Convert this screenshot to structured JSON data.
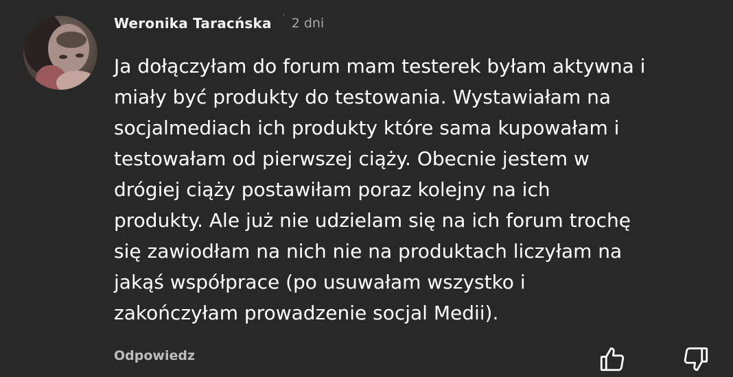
{
  "comment": {
    "author": "Weronika Taracńska",
    "separator": "˙",
    "time": "2 dni",
    "lines": [
      "Ja dołączyłam do forum mam testerek byłam aktywna i",
      "miały być produkty do testowania. Wystawiałam na",
      "socjalmediach ich produkty które sama kupowałam i",
      "testowałam od pierwszej ciąży. Obecnie jestem w",
      "drógiej ciąży postawiłam poraz kolejny na ich",
      "produkty. Ale już nie udzielam się na ich forum trochę",
      "się zawiodłam na nich nie na produktach liczyłam na",
      "jakąś współprace (po usuwałam wszystko i",
      "zakończyłam prowadzenie socjal Medii)."
    ]
  },
  "actions": {
    "reply_label": "Odpowiedz",
    "like_icon": "thumbs-up-icon",
    "dislike_icon": "thumbs-down-icon"
  },
  "colors": {
    "background": "#282828",
    "text": "#ffffff",
    "muted": "#a8a8a8"
  }
}
